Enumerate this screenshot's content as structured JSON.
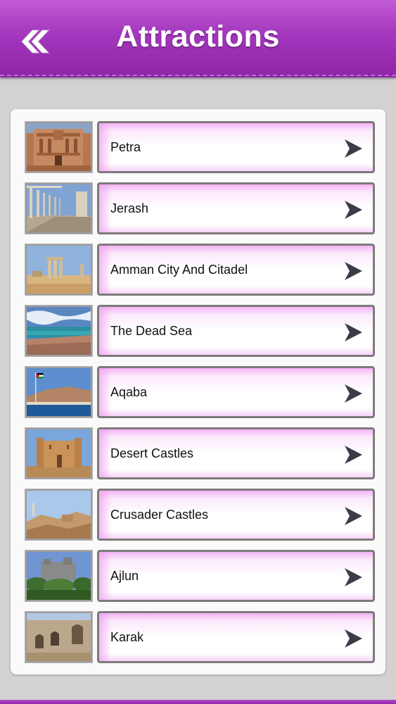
{
  "header": {
    "title": "Attractions",
    "back_icon": "double-chevron-left-icon"
  },
  "list": {
    "items": [
      {
        "label": "Petra",
        "thumb": "petra-treasury"
      },
      {
        "label": "Jerash",
        "thumb": "jerash-columns"
      },
      {
        "label": "Amman City And Citadel",
        "thumb": "citadel-ruins"
      },
      {
        "label": "The Dead Sea",
        "thumb": "dead-sea-shore"
      },
      {
        "label": "Aqaba",
        "thumb": "aqaba-flag-coast"
      },
      {
        "label": "Desert Castles",
        "thumb": "desert-castle"
      },
      {
        "label": "Crusader Castles",
        "thumb": "crusader-ruins"
      },
      {
        "label": "Ajlun",
        "thumb": "ajlun-castle"
      },
      {
        "label": "Karak",
        "thumb": "karak-arches"
      }
    ],
    "chevron_icon": "chevron-right-icon"
  },
  "colors": {
    "header_top": "#c25ad4",
    "header_bottom": "#8f25a8",
    "background": "#d4d1d2",
    "button_border": "#7e7a7b",
    "button_tint": "#f4b3f5",
    "chevron": "#3a3d47"
  }
}
